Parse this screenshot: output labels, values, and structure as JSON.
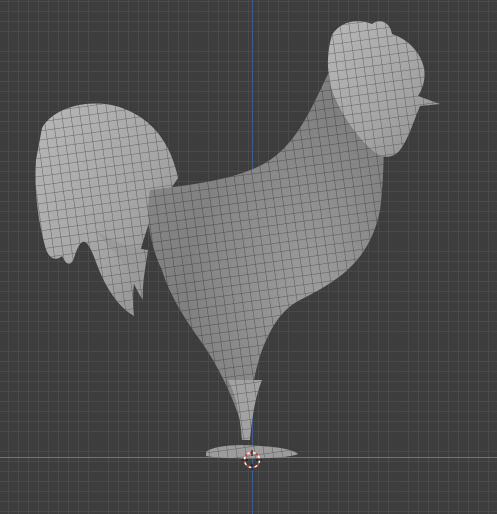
{
  "viewport": {
    "mode": "3d-viewport",
    "grid": true,
    "axes": {
      "x_axis_color": "#5c8c2f",
      "y_axis_color": "#3f5d8f"
    },
    "object_icon": "rooster-wireframe-mesh",
    "cursor_icon": "3d-cursor-icon",
    "colors": {
      "background": "#3d3d3d",
      "mesh": "#a9a9a9",
      "wire": "#4e4e4e"
    }
  }
}
